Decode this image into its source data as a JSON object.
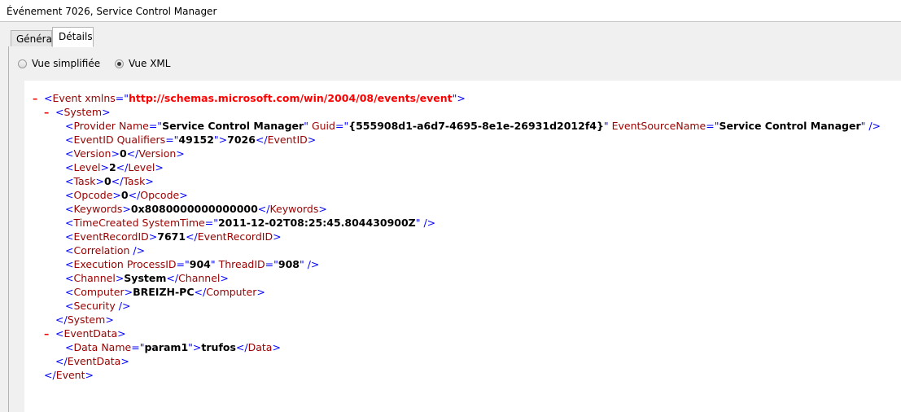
{
  "window": {
    "title": "Événement 7026, Service Control Manager"
  },
  "tabs": [
    {
      "label": "Général"
    },
    {
      "label": "Détails"
    }
  ],
  "view_options": {
    "simplified": {
      "label": "Vue simplifiée",
      "selected": false
    },
    "xml": {
      "label": "Vue XML",
      "selected": true
    }
  },
  "xml": {
    "collapse_symbol": "–",
    "event_open": {
      "lt": "<",
      "name": "Event",
      "attr": "xmlns",
      "eq": "=\"",
      "url": "http://schemas.microsoft.com/win/2004/08/events/event",
      "close": "\">"
    },
    "system_open": {
      "lt": "<",
      "name": "System",
      "gt": ">"
    },
    "provider": {
      "lt": "<",
      "name": "Provider",
      "a1": "Name",
      "v1": "Service Control Manager",
      "a2": "Guid",
      "v2": "{555908d1-a6d7-4695-8e1e-26931d2012f4}",
      "a3": "EventSourceName",
      "v3": "Service Control Manager",
      "end": "/>"
    },
    "eventid": {
      "name": "EventID",
      "a1": "Qualifiers",
      "v1": "49152",
      "text": "7026"
    },
    "version": {
      "name": "Version",
      "text": "0"
    },
    "level": {
      "name": "Level",
      "text": "2"
    },
    "task": {
      "name": "Task",
      "text": "0"
    },
    "opcode": {
      "name": "Opcode",
      "text": "0"
    },
    "keywords": {
      "name": "Keywords",
      "text": "0x8080000000000000"
    },
    "timecreated": {
      "name": "TimeCreated",
      "a1": "SystemTime",
      "v1": "2011-12-02T08:25:45.804430900Z"
    },
    "eventrecordid": {
      "name": "EventRecordID",
      "text": "7671"
    },
    "correlation": {
      "name": "Correlation"
    },
    "execution": {
      "name": "Execution",
      "a1": "ProcessID",
      "v1": "904",
      "a2": "ThreadID",
      "v2": "908"
    },
    "channel": {
      "name": "Channel",
      "text": "System"
    },
    "computer": {
      "name": "Computer",
      "text": "BREIZH-PC"
    },
    "security": {
      "name": "Security"
    },
    "system_close": {
      "name": "System"
    },
    "eventdata_open": {
      "name": "EventData"
    },
    "data": {
      "name": "Data",
      "a1": "Name",
      "v1": "param1",
      "text": "trufos"
    },
    "eventdata_close": {
      "name": "EventData"
    },
    "event_close": {
      "name": "Event"
    }
  }
}
